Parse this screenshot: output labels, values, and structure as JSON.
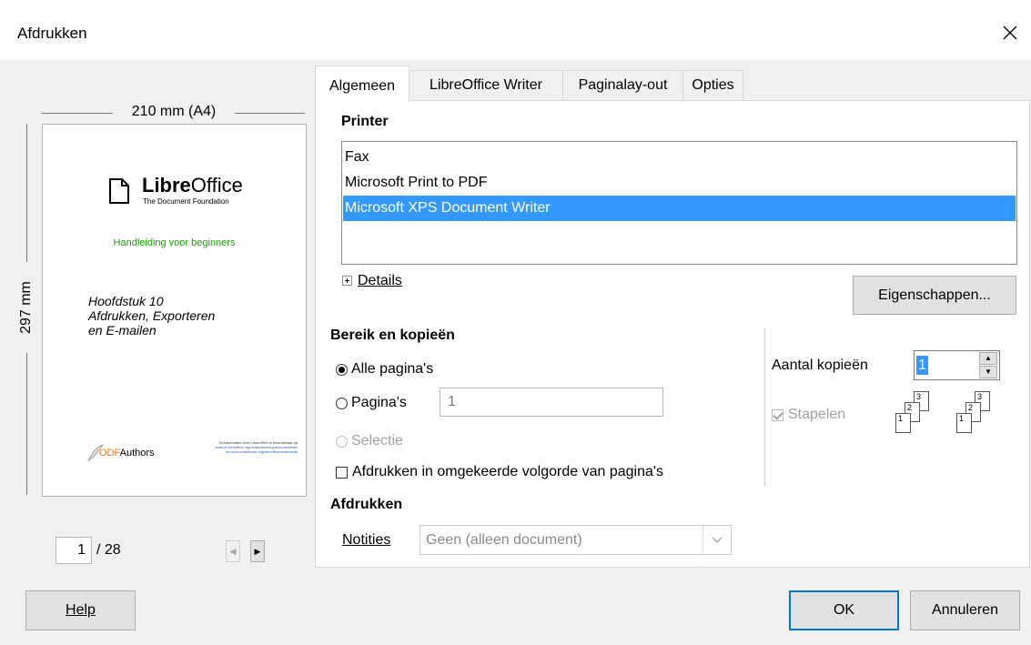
{
  "window": {
    "title": "Afdrukken"
  },
  "preview": {
    "width_label": "210 mm (A4)",
    "height_label": "297 mm",
    "logo_name_a": "Libre",
    "logo_name_b": "Office",
    "logo_foundation": "The Document Foundation",
    "subtitle": "Handleiding voor beginners",
    "chapter_lines": [
      "Hoofdstuk 10",
      "Afdrukken, Exporteren",
      "en E-mailen"
    ],
    "odf_a": "ODF",
    "odf_b": "Authors",
    "small_text_lines": [
      "Documentatie voor LibreOffice is beschikbaar op",
      "www.nl.libreoffice.org/ondersteuning/documentatie/",
      "en www.odfauthors.org/libreofficenederlands"
    ],
    "current_page": "1",
    "total_pages": "/ 28"
  },
  "tabs": [
    "Algemeen",
    "LibreOffice Writer",
    "Paginalay-out",
    "Opties"
  ],
  "printer": {
    "heading": "Printer",
    "items": [
      "Fax",
      "Microsoft Print to PDF",
      "Microsoft XPS Document Writer"
    ],
    "selected_index": 2,
    "details_label": "Details",
    "properties_button": "Eigenschappen..."
  },
  "range": {
    "heading": "Bereik en kopieën",
    "all_pages": "Alle pagina's",
    "pages": "Pagina's",
    "pages_value": "1",
    "selection": "Selectie",
    "reverse": "Afdrukken in omgekeerde volgorde van pagina's",
    "copies_label": "Aantal kopieën",
    "copies_value": "1",
    "collate": "Stapelen"
  },
  "print": {
    "heading": "Afdrukken",
    "notes_label": "Notities",
    "notes_value": "Geen (alleen document)"
  },
  "buttons": {
    "help": "Help",
    "ok": "OK",
    "cancel": "Annuleren"
  }
}
